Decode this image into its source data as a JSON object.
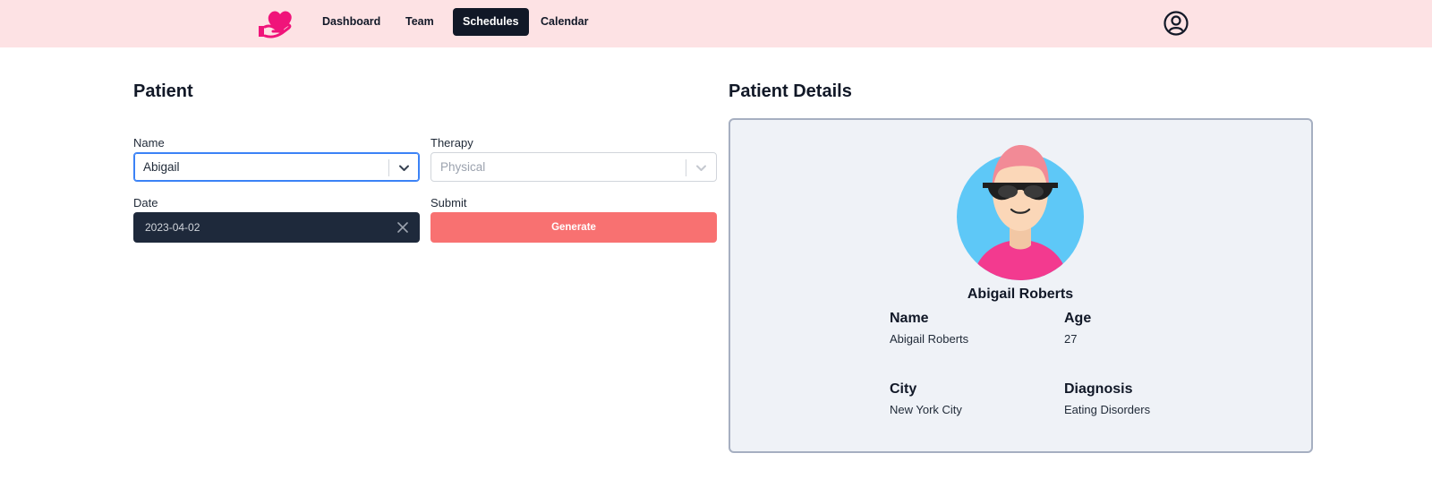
{
  "nav": {
    "items": [
      {
        "label": "Dashboard"
      },
      {
        "label": "Team"
      },
      {
        "label": "Schedules",
        "active": true
      },
      {
        "label": "Calendar"
      }
    ]
  },
  "colors": {
    "navbar_bg": "#fde2e4",
    "brand_pink": "#f0147a",
    "active_nav_bg": "#111827",
    "generate_button_bg": "#f87171",
    "date_input_bg": "#1e293b",
    "card_bg": "#eff2f7"
  },
  "icons": {
    "logo": "heart-hand-icon",
    "account": "user-circle-icon",
    "select_arrow": "chevron-down-icon",
    "date_clear": "close-icon"
  },
  "form": {
    "title": "Patient",
    "name": {
      "label": "Name",
      "value": "Abigail"
    },
    "therapy": {
      "label": "Therapy",
      "value": "Physical"
    },
    "date": {
      "label": "Date",
      "value": "2023-04-02"
    },
    "submit": {
      "label": "Submit",
      "button_label": "Generate"
    }
  },
  "details": {
    "title": "Patient Details",
    "full_name": "Abigail Roberts",
    "fields": {
      "name": {
        "label": "Name",
        "value": "Abigail Roberts"
      },
      "age": {
        "label": "Age",
        "value": "27"
      },
      "city": {
        "label": "City",
        "value": "New York City"
      },
      "diagnosis": {
        "label": "Diagnosis",
        "value": "Eating Disorders"
      }
    }
  }
}
